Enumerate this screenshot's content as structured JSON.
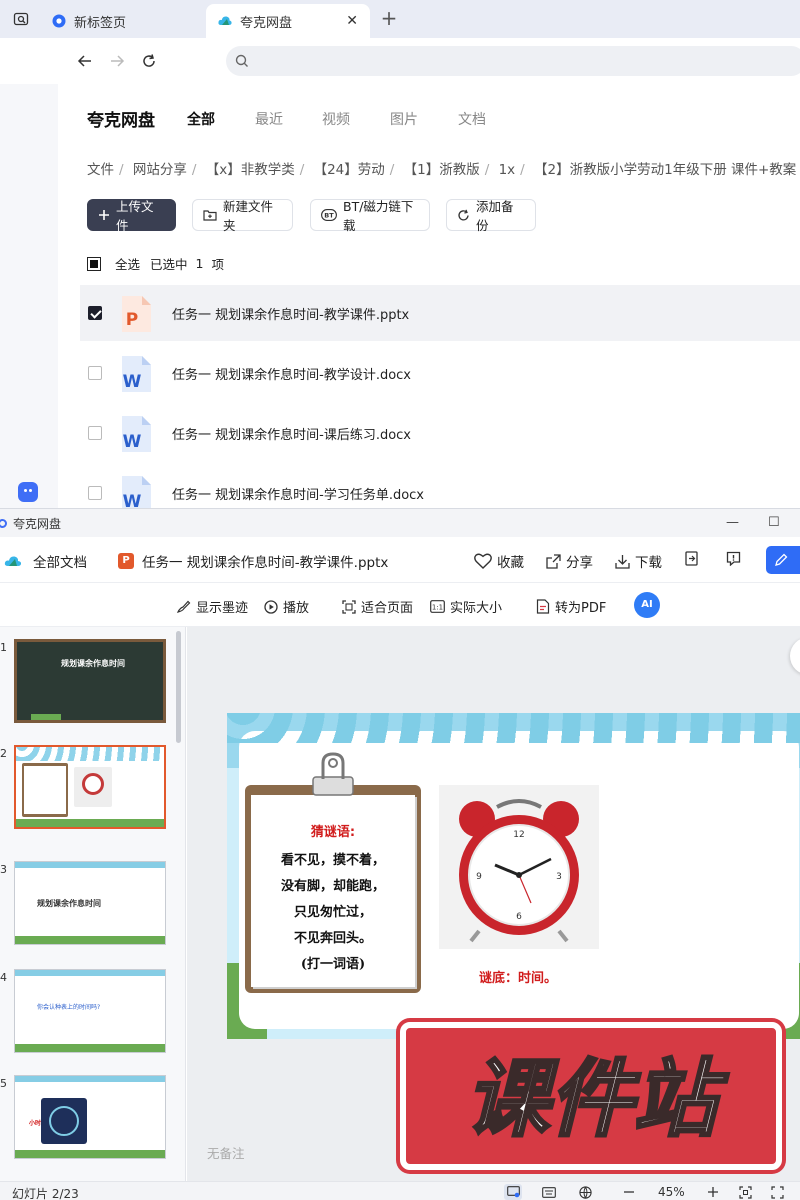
{
  "browser": {
    "tabs": [
      {
        "label": "新标签页",
        "active": false
      },
      {
        "label": "夸克网盘",
        "active": true
      }
    ],
    "new_tab": "+",
    "close": "✕",
    "address": ""
  },
  "drive": {
    "brand": "夸克网盘",
    "nav": [
      "全部",
      "最近",
      "视频",
      "图片",
      "文档"
    ],
    "breadcrumb": [
      "文件",
      "网站分享",
      "【x】非教学类",
      "【24】劳动",
      "【1】浙教版",
      "1x",
      "【2】浙教版小学劳动1年级下册 课件+教案"
    ],
    "actions": {
      "upload": "上传文件",
      "new_folder": "新建文件夹",
      "bt": "BT/磁力链下载",
      "backup": "添加备份"
    },
    "selection": {
      "select_all": "全选",
      "selected": "已选中",
      "count": "1",
      "unit": "项"
    },
    "files": [
      {
        "name": "任务一 规划课余作息时间-教学课件.pptx",
        "type": "ppt",
        "checked": true
      },
      {
        "name": "任务一 规划课余作息时间-教学设计.docx",
        "type": "word",
        "checked": false
      },
      {
        "name": "任务一 规划课余作息时间-课后练习.docx",
        "type": "word",
        "checked": false
      },
      {
        "name": "任务一 规划课余作息时间-学习任务单.docx",
        "type": "word",
        "checked": false
      }
    ]
  },
  "viewer": {
    "window_title": "夸克网盘",
    "min": "—",
    "max": "☐",
    "all_docs": "全部文档",
    "doc_title": "任务一 规划课余作息时间-教学课件.pptx",
    "ppt_badge": "P",
    "actions": {
      "favorite": "收藏",
      "share": "分享",
      "download": "下载"
    },
    "tools": {
      "ink": "显示墨迹",
      "play": "播放",
      "fit": "适合页面",
      "actual": "实际大小",
      "to_pdf": "转为PDF",
      "ai": "AI"
    },
    "thumbnails": [
      {
        "num": "1",
        "text": "规划课余作息时间"
      },
      {
        "num": "2",
        "text": ""
      },
      {
        "num": "3",
        "text": "规划课余作息时间"
      },
      {
        "num": "4",
        "text": "你会认种表上的时间吗?"
      },
      {
        "num": "5",
        "text": "小时"
      }
    ],
    "slide": {
      "riddle_title": "猜谜语:",
      "riddle_lines": [
        "看不见，摸不着，",
        "没有脚，却能跑，",
        "只见匆忙过，",
        "不见奔回头。",
        "(打一词语)"
      ],
      "answer": "谜底：时间。"
    },
    "no_notes": "无备注",
    "status": {
      "page": "幻灯片 2/23",
      "zoom": "45%"
    }
  },
  "watermark": {
    "text": "课件站"
  },
  "colors": {
    "accent": "#2f6cf6",
    "ppt": "#e2592c",
    "word": "#2b5fcc",
    "riddle_red": "#d11d1d",
    "watermark": "#d63a44"
  }
}
